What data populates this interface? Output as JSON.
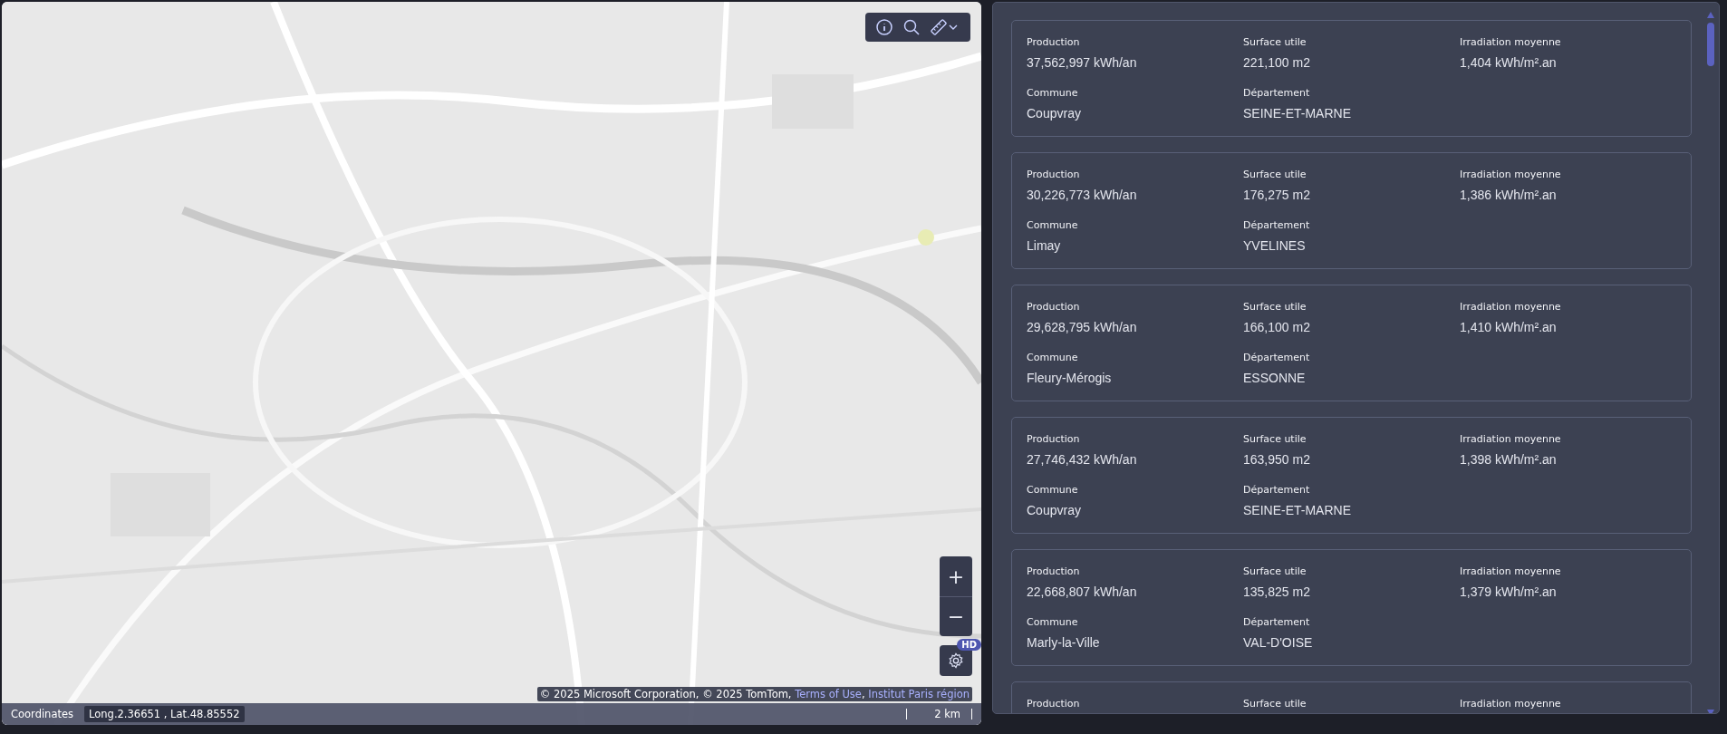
{
  "map": {
    "toolbar": {
      "buttons": [
        {
          "kind": "info"
        },
        {
          "kind": "search"
        },
        {
          "kind": "measure"
        }
      ]
    },
    "zoom_in": "+",
    "zoom_out": "−",
    "hd_badge": "HD",
    "attribution": {
      "text": "© 2025 Microsoft Corporation, © 2025 TomTom, ",
      "links": [
        "Terms of Use",
        "Institut Paris région"
      ],
      "separator": ", "
    },
    "coordinates": {
      "label": "Coordinates",
      "value": "Long.2.36651 , Lat.48.85552"
    },
    "scale": "2 km"
  },
  "results": [
    {
      "fields": [
        {
          "label": "Production",
          "value": "37,562,997 kWh/an"
        },
        {
          "label": "Surface utile",
          "value": "221,100 m2"
        },
        {
          "label": "Irradiation moyenne",
          "value": "1,404 kWh/m².an"
        },
        {
          "label": "Commune",
          "value": "Coupvray"
        },
        {
          "label": "Département",
          "value": "SEINE-ET-MARNE"
        }
      ]
    },
    {
      "fields": [
        {
          "label": "Production",
          "value": "30,226,773 kWh/an"
        },
        {
          "label": "Surface utile",
          "value": "176,275 m2"
        },
        {
          "label": "Irradiation moyenne",
          "value": "1,386 kWh/m².an"
        },
        {
          "label": "Commune",
          "value": "Limay"
        },
        {
          "label": "Département",
          "value": "YVELINES"
        }
      ]
    },
    {
      "fields": [
        {
          "label": "Production",
          "value": "29,628,795 kWh/an"
        },
        {
          "label": "Surface utile",
          "value": "166,100 m2"
        },
        {
          "label": "Irradiation moyenne",
          "value": "1,410 kWh/m².an"
        },
        {
          "label": "Commune",
          "value": "Fleury-Mérogis"
        },
        {
          "label": "Département",
          "value": "ESSONNE"
        }
      ]
    },
    {
      "fields": [
        {
          "label": "Production",
          "value": "27,746,432 kWh/an"
        },
        {
          "label": "Surface utile",
          "value": "163,950 m2"
        },
        {
          "label": "Irradiation moyenne",
          "value": "1,398 kWh/m².an"
        },
        {
          "label": "Commune",
          "value": "Coupvray"
        },
        {
          "label": "Département",
          "value": "SEINE-ET-MARNE"
        }
      ]
    },
    {
      "fields": [
        {
          "label": "Production",
          "value": "22,668,807 kWh/an"
        },
        {
          "label": "Surface utile",
          "value": "135,825 m2"
        },
        {
          "label": "Irradiation moyenne",
          "value": "1,379 kWh/m².an"
        },
        {
          "label": "Commune",
          "value": "Marly-la-Ville"
        },
        {
          "label": "Département",
          "value": "VAL-D'OISE"
        }
      ]
    },
    {
      "fields": [
        {
          "label": "Production"
        },
        {
          "label": "Surface utile"
        },
        {
          "label": "Irradiation moyenne"
        }
      ]
    }
  ]
}
